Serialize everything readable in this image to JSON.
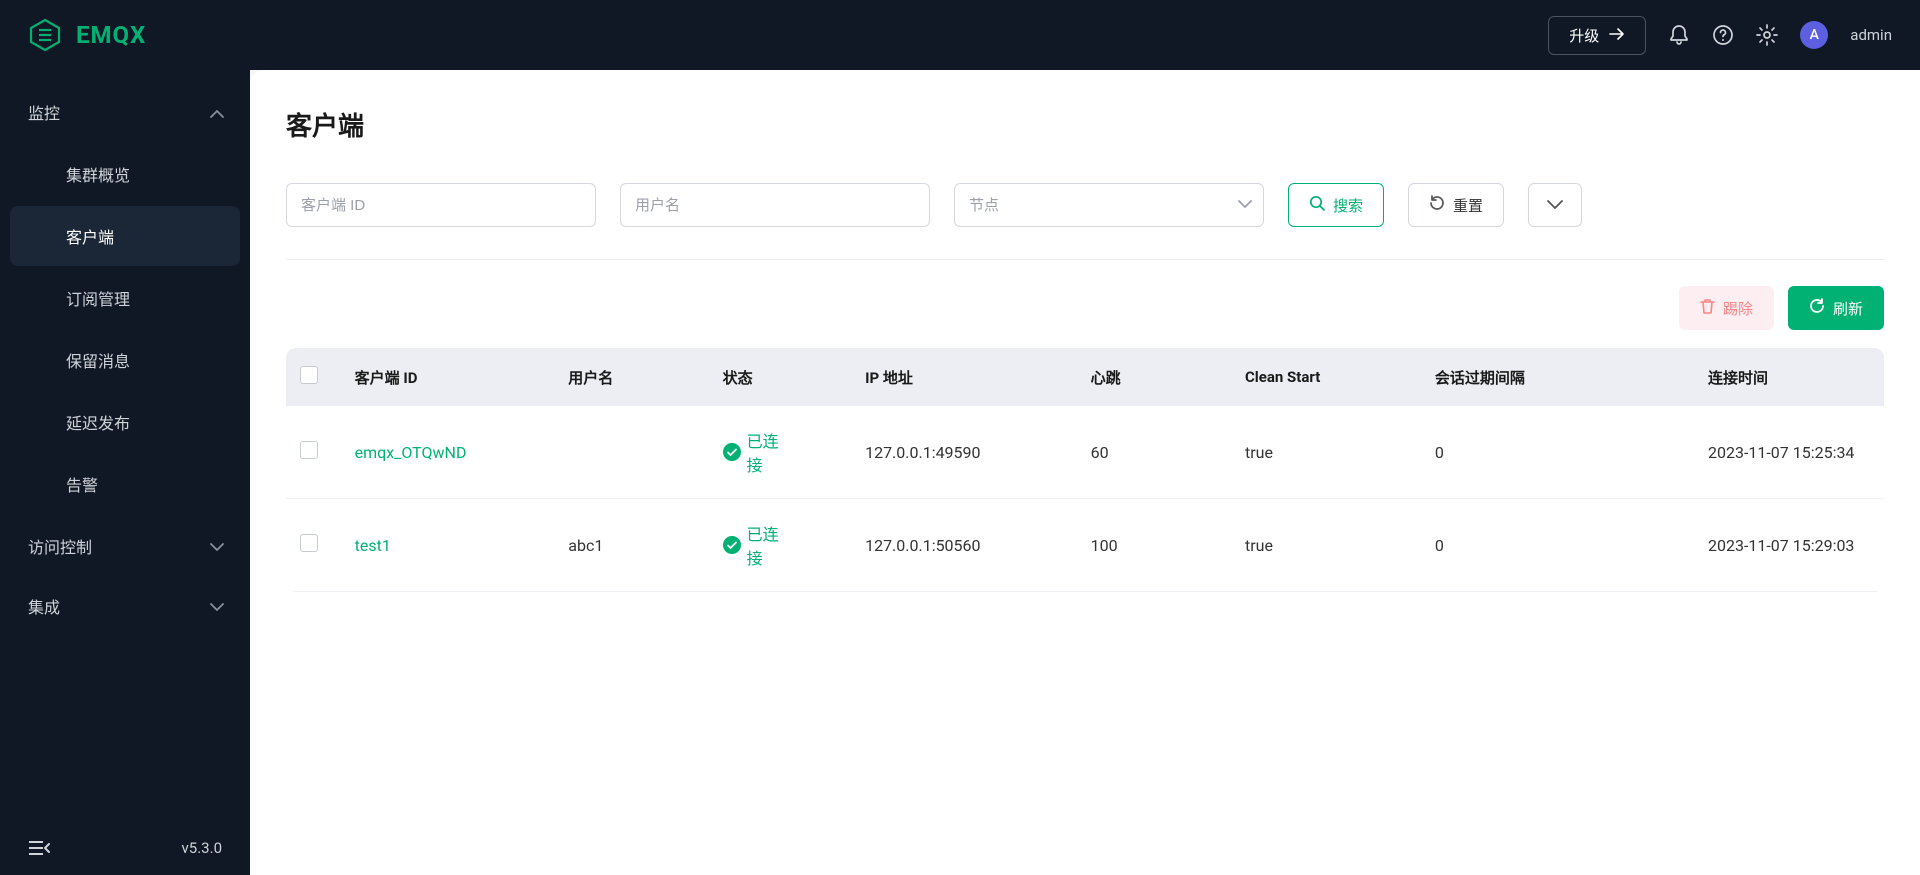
{
  "header": {
    "brand": "EMQX",
    "upgrade_label": "升级",
    "username": "admin",
    "avatar_letter": "A"
  },
  "sidebar": {
    "version": "v5.3.0",
    "groups": [
      {
        "label": "监控",
        "expanded": true,
        "items": [
          {
            "label": "集群概览",
            "active": false
          },
          {
            "label": "客户端",
            "active": true
          },
          {
            "label": "订阅管理",
            "active": false
          },
          {
            "label": "保留消息",
            "active": false
          },
          {
            "label": "延迟发布",
            "active": false
          },
          {
            "label": "告警",
            "active": false
          }
        ]
      },
      {
        "label": "访问控制",
        "expanded": false,
        "items": []
      },
      {
        "label": "集成",
        "expanded": false,
        "items": []
      }
    ]
  },
  "page": {
    "title": "客户端"
  },
  "filters": {
    "client_id_placeholder": "客户端 ID",
    "username_placeholder": "用户名",
    "node_placeholder": "节点",
    "search_label": "搜索",
    "reset_label": "重置"
  },
  "actions": {
    "kick_label": "踢除",
    "refresh_label": "刷新"
  },
  "table": {
    "headers": {
      "client_id": "客户端 ID",
      "username": "用户名",
      "status": "状态",
      "ip": "IP 地址",
      "keepalive": "心跳",
      "clean_start": "Clean Start",
      "expiry": "会话过期间隔",
      "connected_at": "连接时间"
    },
    "rows": [
      {
        "client_id": "emqx_OTQwND",
        "username": "",
        "status": "已连接",
        "ip": "127.0.0.1:49590",
        "keepalive": "60",
        "clean_start": "true",
        "expiry": "0",
        "connected_at": "2023-11-07 15:25:34"
      },
      {
        "client_id": "test1",
        "username": "abc1",
        "status": "已连接",
        "ip": "127.0.0.1:50560",
        "keepalive": "100",
        "clean_start": "true",
        "expiry": "0",
        "connected_at": "2023-11-07 15:29:03"
      }
    ]
  }
}
